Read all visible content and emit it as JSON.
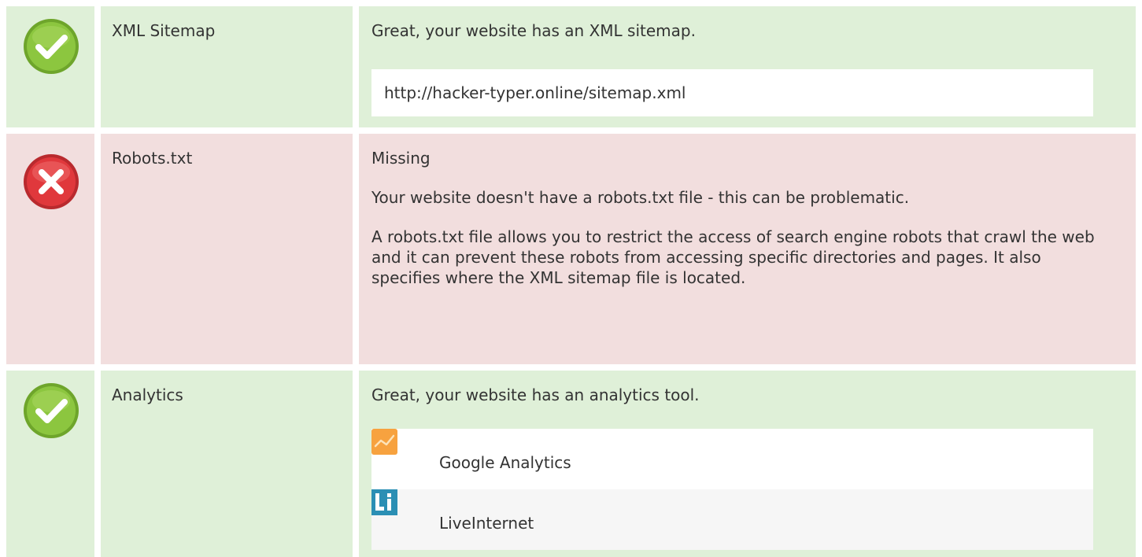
{
  "rows": [
    {
      "status": "pass",
      "icon": "check-circle-icon",
      "label": "XML Sitemap",
      "message": "Great, your website has an XML sitemap.",
      "url": "http://hacker-typer.online/sitemap.xml"
    },
    {
      "status": "fail",
      "icon": "cross-circle-icon",
      "label": "Robots.txt",
      "message": "Missing",
      "detail_1": "Your website doesn't have a robots.txt file - this can be problematic.",
      "detail_2": "A robots.txt file allows you to restrict the access of search engine robots that crawl the web and it can prevent these robots from accessing specific directories and pages. It also specifies where the XML sitemap file is located."
    },
    {
      "status": "pass",
      "icon": "check-circle-icon",
      "label": "Analytics",
      "message": "Great, your website has an analytics tool.",
      "tools": [
        {
          "name": "Google Analytics",
          "icon": "google-analytics-icon"
        },
        {
          "name": "LiveInternet",
          "icon": "liveinternet-icon"
        }
      ]
    }
  ],
  "colors": {
    "pass_bg": "#dff0d8",
    "fail_bg": "#f2dede",
    "pass_icon": "#8cc63f",
    "fail_icon": "#e0383c",
    "ga_orange": "#f7a23f",
    "li_blue": "#2b8fb4"
  }
}
